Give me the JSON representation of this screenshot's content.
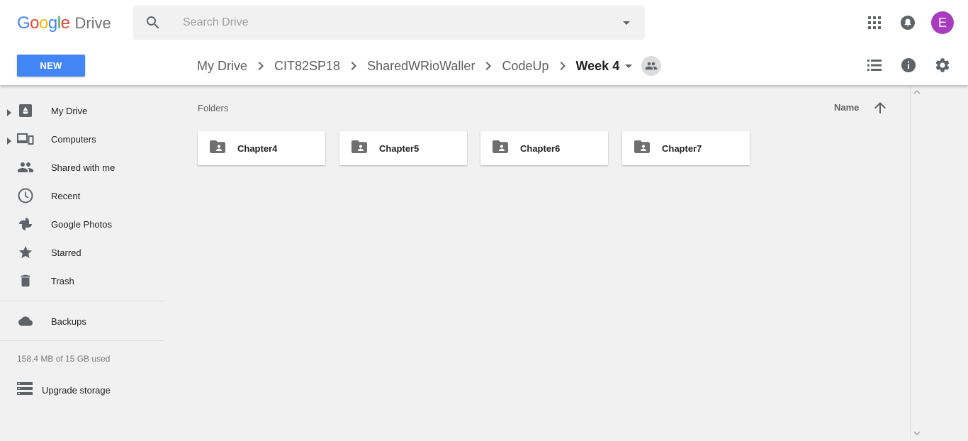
{
  "app": {
    "logo_google_letters": [
      "G",
      "o",
      "o",
      "g",
      "l",
      "e"
    ],
    "logo_word": "Drive",
    "logo_colors": [
      "#4285f4",
      "#ea4335",
      "#fbbc05",
      "#4285f4",
      "#34a853",
      "#ea4335"
    ]
  },
  "search": {
    "placeholder": "Search Drive",
    "icon": "search-icon",
    "options_icon": "caret-down-icon"
  },
  "top_icons": [
    "apps-grid-icon",
    "notifications-bell-icon"
  ],
  "account": {
    "avatar_letter": "E",
    "avatar_color": "#a83bbf"
  },
  "new_button": {
    "label": "NEW",
    "color": "#4285f4"
  },
  "breadcrumb": {
    "items": [
      "My Drive",
      "CIT82SP18",
      "SharedWRioWaller",
      "CodeUp"
    ],
    "current": "Week 4",
    "separator_icon": "chevron-right-icon",
    "shared_icon": "people-icon"
  },
  "view_tools": [
    "list-view-icon",
    "info-icon",
    "settings-gear-icon"
  ],
  "sidebar": {
    "items": [
      {
        "label": "My Drive",
        "icon": "drive-icon",
        "expandable": true
      },
      {
        "label": "Computers",
        "icon": "computers-icon",
        "expandable": true
      },
      {
        "label": "Shared with me",
        "icon": "people-icon",
        "expandable": false
      },
      {
        "label": "Recent",
        "icon": "clock-icon",
        "expandable": false
      },
      {
        "label": "Google Photos",
        "icon": "pinwheel-icon",
        "expandable": false
      },
      {
        "label": "Starred",
        "icon": "star-icon",
        "expandable": false
      },
      {
        "label": "Trash",
        "icon": "trash-icon",
        "expandable": false
      }
    ],
    "backups": {
      "label": "Backups",
      "icon": "cloud-icon"
    },
    "storage_text": "158.4 MB of 15 GB used",
    "upgrade": {
      "label": "Upgrade storage",
      "icon": "storage-icon"
    }
  },
  "main": {
    "section_title": "Folders",
    "sort": {
      "label": "Name",
      "direction": "ascending",
      "icon": "arrow-up-icon"
    },
    "folders": [
      {
        "name": "Chapter4",
        "icon": "shared-folder-icon"
      },
      {
        "name": "Chapter5",
        "icon": "shared-folder-icon"
      },
      {
        "name": "Chapter6",
        "icon": "shared-folder-icon"
      },
      {
        "name": "Chapter7",
        "icon": "shared-folder-icon"
      }
    ]
  },
  "colors": {
    "icon_gray": "#5f6368",
    "background": "#f1f1f1",
    "header": "#ffffff"
  }
}
